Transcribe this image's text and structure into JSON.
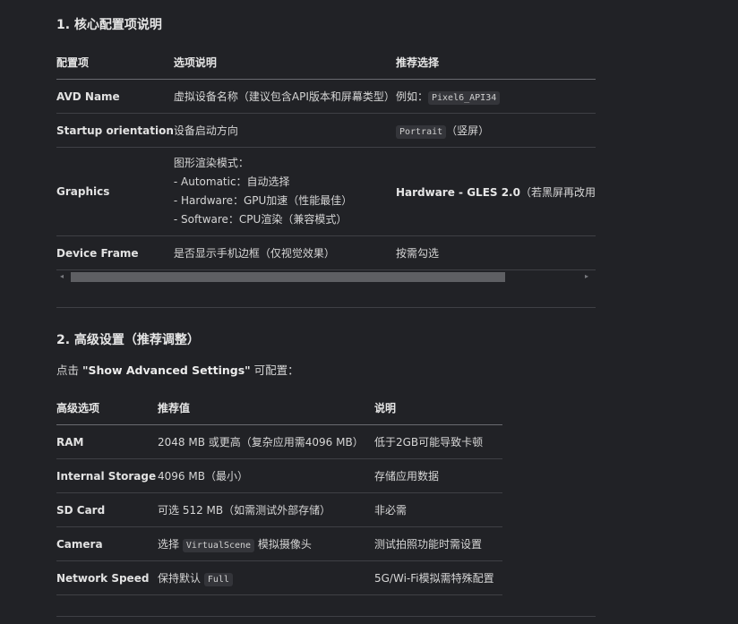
{
  "section1": {
    "heading": "1. 核心配置项说明",
    "headers": [
      "配置项",
      "选项说明",
      "推荐选择"
    ],
    "rows": [
      {
        "name": "AVD Name",
        "desc": "虚拟设备名称（建议包含API版本和屏幕类型）",
        "rec_prefix": "例如：",
        "rec_code": "Pixel6_API34",
        "rec_suffix": ""
      },
      {
        "name": "Startup orientation",
        "desc": "设备启动方向",
        "rec_prefix": "",
        "rec_code": "Portrait",
        "rec_suffix": "（竖屏）"
      },
      {
        "name": "Graphics",
        "desc_lines": [
          "图形渲染模式：",
          "- Automatic：自动选择",
          "- Hardware：GPU加速（性能最佳）",
          "- Software：CPU渲染（兼容模式）"
        ],
        "rec_bold": "Hardware - GLES 2.0",
        "rec_suffix": "（若黑屏再改用"
      },
      {
        "name": "Device Frame",
        "desc": "是否显示手机边框（仅视觉效果）",
        "rec_prefix": "按需勾选"
      }
    ]
  },
  "section2": {
    "heading": "2. 高级设置（推荐调整）",
    "intro_prefix": "点击 ",
    "intro_bold": "\"Show Advanced Settings\"",
    "intro_suffix": " 可配置：",
    "headers": [
      "高级选项",
      "推荐值",
      "说明"
    ],
    "rows": [
      {
        "name": "RAM",
        "value": "2048 MB 或更高（复杂应用需4096 MB）",
        "note": "低于2GB可能导致卡顿"
      },
      {
        "name": "Internal Storage",
        "value": "4096 MB（最小）",
        "note": "存储应用数据"
      },
      {
        "name": "SD Card",
        "value": "可选 512 MB（如需测试外部存储）",
        "note": "非必需"
      },
      {
        "name": "Camera",
        "value_prefix": "选择 ",
        "value_code": "VirtualScene",
        "value_suffix": " 模拟摄像头",
        "note": "测试拍照功能时需设置"
      },
      {
        "name": "Network Speed",
        "value_prefix": "保持默认 ",
        "value_code": "Full",
        "value_suffix": "",
        "note": "5G/Wi-Fi模拟需特殊配置"
      }
    ]
  },
  "scrollbar": {
    "left_arrow": "◂",
    "right_arrow": "▸",
    "thumb_fraction": 0.85
  }
}
